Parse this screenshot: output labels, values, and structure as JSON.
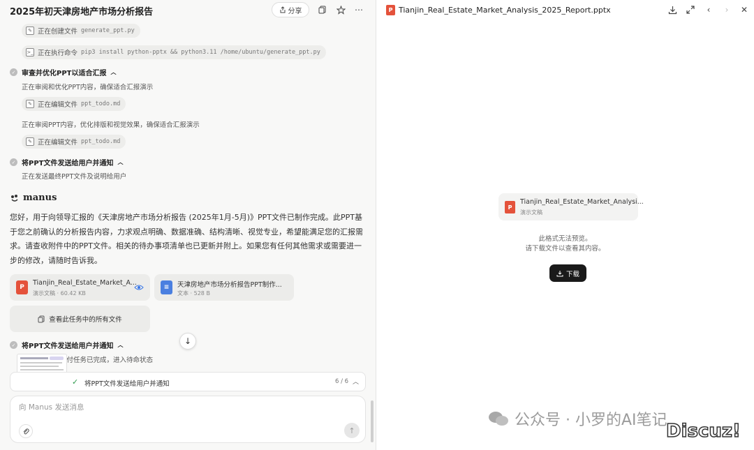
{
  "left": {
    "title": "2025年初天津房地产市场分析报告",
    "share_label": "分享",
    "chips": [
      {
        "label": "正在创建文件",
        "code": "generate_ppt.py"
      },
      {
        "label": "正在执行命令",
        "code": "pip3 install python-pptx && python3.11 /home/ubuntu/generate_ppt.py"
      },
      {
        "label": "正在编辑文件",
        "code": "ppt_todo.md"
      },
      {
        "label": "正在编辑文件",
        "code": "ppt_todo.md"
      }
    ],
    "steps": [
      {
        "title": "审查并优化PPT以适合汇报"
      },
      {
        "title": "将PPT文件发送给用户并通知"
      },
      {
        "title": "将PPT文件发送给用户并通知"
      }
    ],
    "descs": [
      "正在审阅和优化PPT内容，确保适合汇报演示",
      "正在审阅PPT内容，优化排版和视觉效果，确保适合汇报演示",
      "正在发送最终PPT文件及说明给用户",
      "交付任务已完成，进入待命状态"
    ],
    "brand": "manus",
    "message": "您好，用于向领导汇报的《天津房地产市场分析报告 (2025年1月-5月)》PPT文件已制作完成。此PPT基于您之前确认的分析报告内容，力求观点明确、数据准确、结构清晰、视觉专业，希望能满足您的汇报需求。请查收附件中的PPT文件。相关的待办事项清单也已更新并附上。如果您有任何其他需求或需要进一步的修改，请随时告诉我。",
    "files": [
      {
        "name": "Tianjin_Real_Estate_Market_A...",
        "meta": "演示文稿 · 60.42 KB",
        "icon": "P",
        "color": "#e4523b"
      },
      {
        "name": "天津房地产市场分析报告PPT制作...",
        "meta": "文本 · 528 B",
        "icon": "≡",
        "color": "#4a7fe0"
      }
    ],
    "all_files_label": "查看此任务中的所有文件",
    "task_bar": {
      "label": "将PPT文件发送给用户并通知",
      "count": "6 / 6"
    },
    "input_placeholder": "向 Manus 发送消息"
  },
  "right": {
    "title": "Tianjin_Real_Estate_Market_Analysis_2025_Report.pptx",
    "preview_name": "Tianjin_Real_Estate_Market_Analysi...",
    "preview_meta": "演示文稿",
    "no_preview_line1": "此格式无法预览。",
    "no_preview_line2": "请下载文件以查看其内容。",
    "download_label": "下载"
  },
  "watermark": {
    "text": "公众号 · 小罗的AI笔记",
    "discuz": "Discuz!"
  },
  "colors": {
    "accent_ppt": "#e4523b",
    "accent_doc": "#4a7fe0",
    "success": "#2e9a4c"
  }
}
